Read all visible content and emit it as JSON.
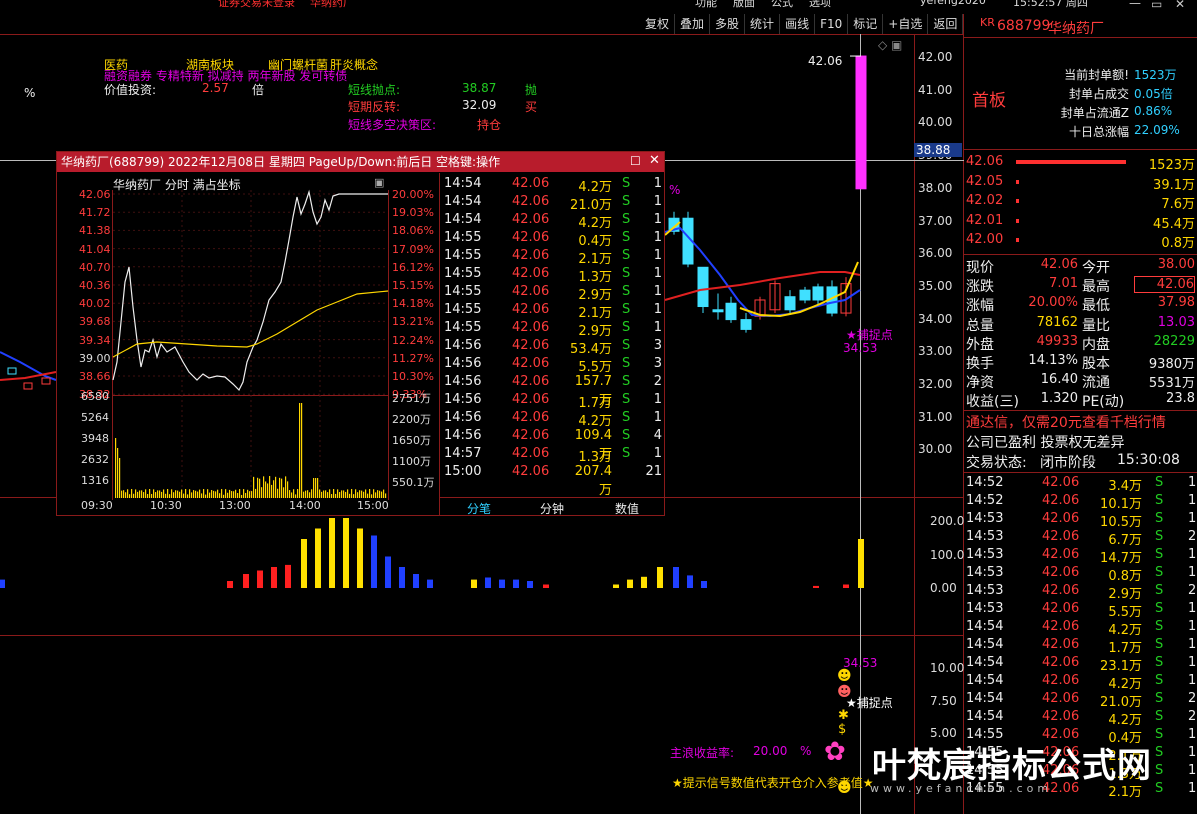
{
  "header": {
    "strip_left": "证券交易未登录",
    "strip_stock": "华纳药厂",
    "strip_menu": [
      "功能",
      "版面",
      "公式",
      "选项"
    ],
    "user": "yefeng2020",
    "time": "15:52:57 周四"
  },
  "toolbar": [
    "复权",
    "叠加",
    "多股",
    "统计",
    "画线",
    "F10",
    "标记",
    "+自选",
    "返回"
  ],
  "info_panel": {
    "tags": [
      "医药",
      "湖南板块",
      "幽门螺杆菌",
      "肝炎概念"
    ],
    "tags2": "融资融券 专精特新 拟减持 两年新股 发可转债",
    "percent": "%",
    "value_label": "价值投资:",
    "value_num": "2.57",
    "value_unit": "倍",
    "short_sell_label": "短线抛点:",
    "short_sell_val": "38.87",
    "short_sell_sig": "抛",
    "short_rev_label": "短期反转:",
    "short_rev_val": "32.09",
    "short_rev_sig": "买",
    "decision_label": "短线多空决策区:",
    "decision_val": "持仓"
  },
  "main_chart": {
    "price_axis": [
      "42.00",
      "41.00",
      "40.00",
      "39.00",
      "38.00",
      "37.00",
      "36.00",
      "35.00",
      "34.00",
      "33.00",
      "32.00",
      "31.00",
      "30.00"
    ],
    "high_label": "42.06",
    "cursor_price": "38.88",
    "capture_label": "★捕捉点",
    "capture_value": "34.53",
    "pct": "%",
    "vol_axis": [
      "200.0",
      "100.0",
      "0.00"
    ],
    "ind_axis": [
      "10.00",
      "7.50",
      "5.00"
    ],
    "ind_value": "34.53",
    "ind_capture": "★捕捉点",
    "wave_label": "主浪收益率:",
    "wave_value": "20.00",
    "wave_pct": "%",
    "signal_note": "★提示信号数值代表开仓介入参考值★"
  },
  "right_panel": {
    "code_prefix": "KR",
    "code": "688799",
    "name": "华纳药厂",
    "board": "首板",
    "seal_rows": [
      {
        "label": "!当前封单额",
        "value": "1523万"
      },
      {
        "label": "封单占成交",
        "value": "0.05倍"
      },
      {
        "label": "封单占流通Z",
        "value": "0.86%"
      },
      {
        "label": "十日总涨幅",
        "value": "22.09%"
      }
    ],
    "bids": [
      {
        "price": "42.06",
        "vol": "1523万",
        "bar": 1.0
      },
      {
        "price": "42.05",
        "vol": "39.1万",
        "bar": 0.02
      },
      {
        "price": "42.02",
        "vol": "7.6万",
        "bar": 0.02
      },
      {
        "price": "42.01",
        "vol": "45.4万",
        "bar": 0.02
      },
      {
        "price": "42.00",
        "vol": "0.8万",
        "bar": 0.02
      }
    ],
    "quote": [
      [
        "现价",
        "42.06",
        "今开",
        "38.00"
      ],
      [
        "涨跌",
        "7.01",
        "最高",
        "42.06"
      ],
      [
        "涨幅",
        "20.00%",
        "最低",
        "37.98"
      ],
      [
        "总量",
        "78162",
        "量比",
        "13.03"
      ],
      [
        "外盘",
        "49933",
        "内盘",
        "28229"
      ],
      [
        "换手",
        "14.13%",
        "股本",
        "9380万"
      ],
      [
        "净资",
        "16.40",
        "流通",
        "5531万"
      ],
      [
        "收益(三)",
        "1.320",
        "PE(动)",
        "23.8"
      ]
    ],
    "ad": "通达信，仅需20元查看千档行情",
    "notice": "公司已盈利 投票权无差异",
    "status_label": "交易状态:",
    "status_value": "闭市阶段",
    "status_time": "15:30:08",
    "ticks": [
      [
        "14:52",
        "42.06",
        "3.4万",
        "S"
      ],
      [
        "14:52",
        "42.06",
        "10.1万",
        "S"
      ],
      [
        "14:53",
        "42.06",
        "10.5万",
        "S"
      ],
      [
        "14:53",
        "42.06",
        "6.7万",
        "S"
      ],
      [
        "14:53",
        "42.06",
        "14.7万",
        "S"
      ],
      [
        "14:53",
        "42.06",
        "0.8万",
        "S"
      ],
      [
        "14:53",
        "42.06",
        "2.9万",
        "S"
      ],
      [
        "14:53",
        "42.06",
        "5.5万",
        "S"
      ],
      [
        "14:54",
        "42.06",
        "4.2万",
        "S"
      ],
      [
        "14:54",
        "42.06",
        "1.7万",
        "S"
      ],
      [
        "14:54",
        "42.06",
        "23.1万",
        "S"
      ],
      [
        "14:54",
        "42.06",
        "4.2万",
        "S"
      ],
      [
        "14:54",
        "42.06",
        "21.0万",
        "S"
      ],
      [
        "14:54",
        "42.06",
        "4.2万",
        "S"
      ],
      [
        "14:55",
        "42.06",
        "0.4万",
        "S"
      ],
      [
        "14:55",
        "42.06",
        "2.1万",
        "S"
      ],
      [
        "14:55",
        "42.06",
        "1.3万",
        "S"
      ],
      [
        "14:55",
        "42.06",
        "2.1万",
        "S"
      ]
    ],
    "tick_extra": [
      "1",
      "1",
      "1",
      "2",
      "1",
      "1",
      "2",
      "1",
      "1",
      "1",
      "1",
      "1",
      "2",
      "2",
      "1",
      "1",
      "1",
      "1"
    ]
  },
  "popup": {
    "title": "华纳药厂(688799) 2022年12月08日 星期四 PageUp/Down:前后日 空格键:操作",
    "sub_title": "华纳药厂  分时  满占坐标",
    "price_ticks": [
      "42.06",
      "41.72",
      "41.38",
      "41.04",
      "40.70",
      "40.36",
      "40.02",
      "39.68",
      "39.34",
      "39.00",
      "38.66",
      "38.32"
    ],
    "pct_ticks": [
      "20.00%",
      "19.03%",
      "18.06%",
      "17.09%",
      "16.12%",
      "15.15%",
      "14.18%",
      "13.21%",
      "12.24%",
      "11.27%",
      "10.30%",
      "9.33%"
    ],
    "vol_ticks": [
      "6580",
      "5264",
      "3948",
      "2632",
      "1316"
    ],
    "vol_ticks_r": [
      "2751万",
      "2200万",
      "1650万",
      "1100万",
      "550.1万"
    ],
    "time_ticks": [
      "09:30",
      "10:30",
      "13:00",
      "14:00",
      "15:00"
    ],
    "tabs": [
      "分笔",
      "分钟",
      "数值"
    ],
    "ticks": [
      [
        "14:54",
        "42.06",
        "4.2万",
        "S",
        "1"
      ],
      [
        "14:54",
        "42.06",
        "21.0万",
        "S",
        "1"
      ],
      [
        "14:54",
        "42.06",
        "4.2万",
        "S",
        "1"
      ],
      [
        "14:55",
        "42.06",
        "0.4万",
        "S",
        "1"
      ],
      [
        "14:55",
        "42.06",
        "2.1万",
        "S",
        "1"
      ],
      [
        "14:55",
        "42.06",
        "1.3万",
        "S",
        "1"
      ],
      [
        "14:55",
        "42.06",
        "2.9万",
        "S",
        "1"
      ],
      [
        "14:55",
        "42.06",
        "2.1万",
        "S",
        "1"
      ],
      [
        "14:55",
        "42.06",
        "2.9万",
        "S",
        "1"
      ],
      [
        "14:56",
        "42.06",
        "53.4万",
        "S",
        "3"
      ],
      [
        "14:56",
        "42.06",
        "5.5万",
        "S",
        "3"
      ],
      [
        "14:56",
        "42.06",
        "157.7万",
        "S",
        "2"
      ],
      [
        "14:56",
        "42.06",
        "1.7万",
        "S",
        "1"
      ],
      [
        "14:56",
        "42.06",
        "4.2万",
        "S",
        "1"
      ],
      [
        "14:56",
        "42.06",
        "109.4万",
        "S",
        "4"
      ],
      [
        "14:57",
        "42.06",
        "1.3万",
        "S",
        "1"
      ],
      [
        "15:00",
        "42.06",
        "207.4万",
        "",
        "21"
      ]
    ]
  },
  "watermark": "叶梵宸指标公式网",
  "watermark_small": "www.yefanchen.com",
  "colors": {
    "up": "#ff3c3c",
    "down": "#22cc22",
    "yellow": "#ffd700",
    "magenta": "#e000e0",
    "title_bar": "#b81c2c"
  }
}
